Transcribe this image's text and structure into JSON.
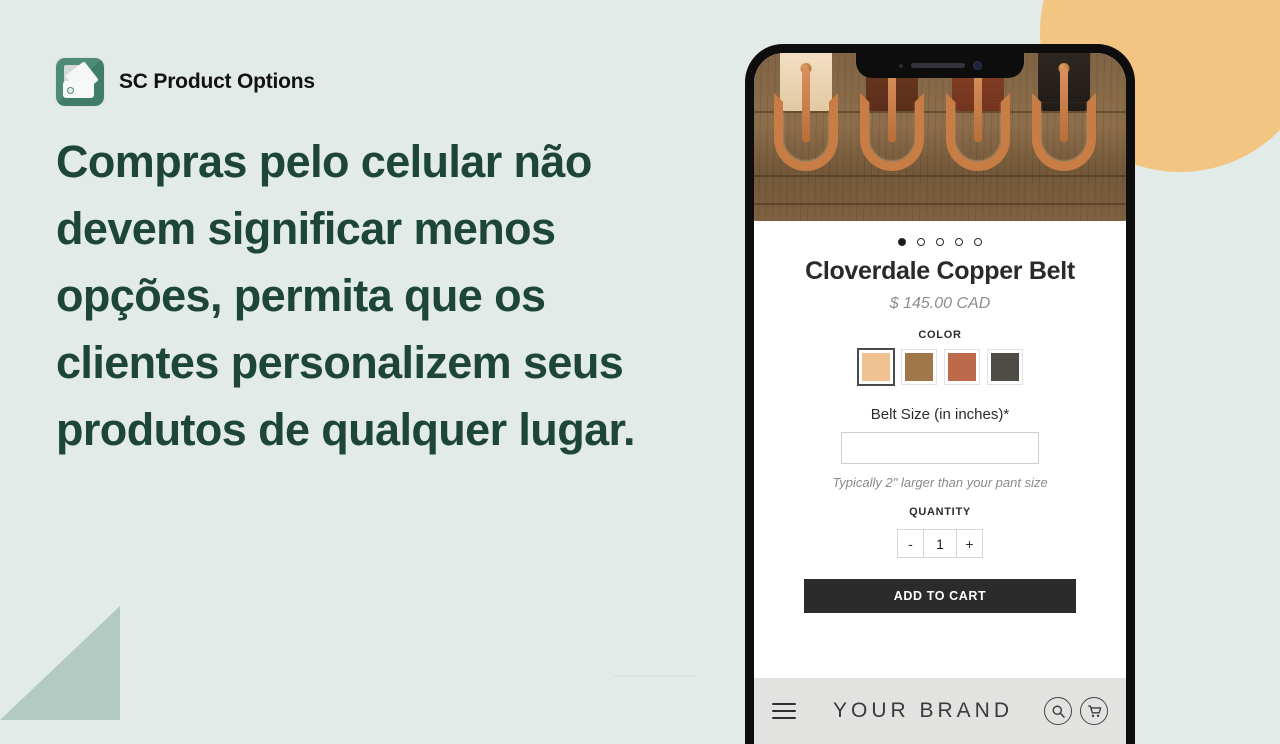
{
  "brand": {
    "logo_icon": "product-options-swatch-icon",
    "name": "SC Product Options"
  },
  "headline": "Compras pelo celular não devem significar menos opções, permita que os clientes personalizem seus produtos de qualquer lugar.",
  "colors": {
    "background": "#e3ebe8",
    "headline_text": "#1d4637",
    "accent_circle": "#f2c682",
    "accent_triangle": "#b3cac2",
    "logo_green": "#4e8c76",
    "button_dark": "#2b2b2b"
  },
  "phone": {
    "gallery": {
      "image_alt": "four leather belts with copper buckles on wood",
      "dot_count": 5,
      "active_dot_index": 0
    },
    "product": {
      "title": "Cloverdale Copper Belt",
      "price": "$ 145.00 CAD",
      "color_label": "COLOR",
      "swatches": [
        {
          "name": "natural-tan",
          "hex": "#f0c291",
          "selected": true
        },
        {
          "name": "medium-brown",
          "hex": "#9f7748",
          "selected": false
        },
        {
          "name": "copper-rust",
          "hex": "#bd6a4c",
          "selected": false
        },
        {
          "name": "dark-charcoal",
          "hex": "#4f4b45",
          "selected": false
        }
      ],
      "size_field": {
        "label": "Belt Size (in inches)*",
        "value": "",
        "placeholder": "",
        "helper": "Typically 2\" larger than your pant size"
      },
      "quantity": {
        "label": "QUANTITY",
        "decrement": "-",
        "value": "1",
        "increment": "+"
      },
      "add_to_cart": "ADD TO CART"
    },
    "bottom_bar": {
      "menu_icon": "hamburger-menu-icon",
      "store_name": "YOUR BRAND",
      "search_icon": "search-icon",
      "cart_icon": "shopping-cart-icon"
    }
  }
}
